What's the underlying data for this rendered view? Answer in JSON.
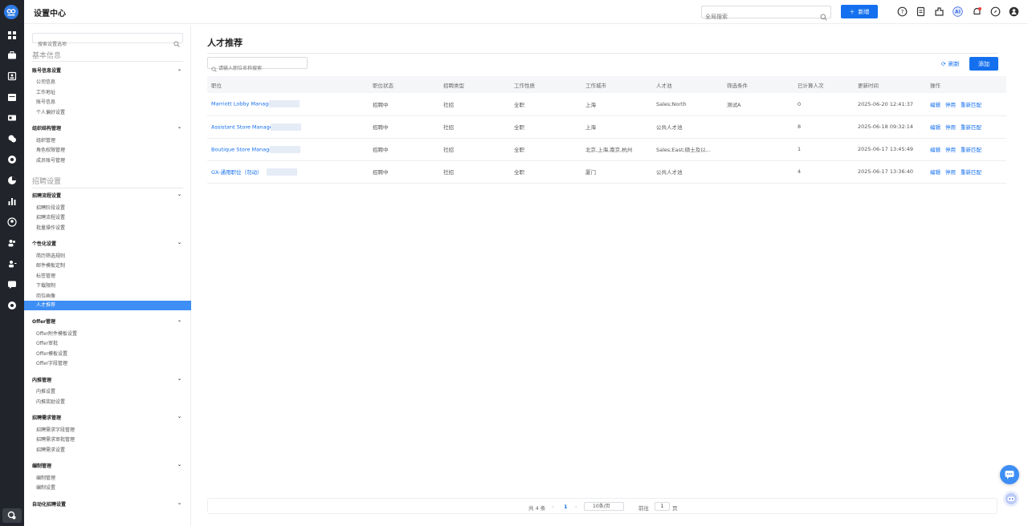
{
  "app": {
    "title": "设置中心"
  },
  "topbar": {
    "search_placeholder": "全局搜索",
    "new_label": "新增",
    "icons": [
      "help-icon",
      "document-icon",
      "plugin-icon",
      "ai-icon",
      "notification-icon",
      "compass-icon",
      "user-icon"
    ],
    "ai_label": "AI"
  },
  "sidebar": {
    "search_placeholder": "搜索设置选项",
    "sections": [
      {
        "title": "基本信息"
      },
      {
        "title": "招聘设置"
      }
    ],
    "groups": [
      {
        "label": "账号信息设置",
        "items": [
          "公司信息",
          "工作地址",
          "账号信息",
          "个人偏好设置"
        ]
      },
      {
        "label": "组织结构管理",
        "items": [
          "组织管理",
          "角色权限管理",
          "成员账号管理"
        ]
      },
      {
        "label": "招聘流程设置",
        "items": [
          "招聘阶段设置",
          "招聘流程设置",
          "批量操作设置"
        ]
      },
      {
        "label": "个性化设置",
        "items": [
          "简历筛选规则",
          "邮件模板定制",
          "标签管理",
          "下载限制",
          "岗位画像",
          "人才推荐"
        ]
      },
      {
        "label": "Offer管理",
        "items": [
          "Offer附件模板设置",
          "Offer审批",
          "Offer模板设置",
          "Offer字段管理"
        ]
      },
      {
        "label": "内推管理",
        "items": [
          "内推设置",
          "内推奖励设置"
        ]
      },
      {
        "label": "招聘需求管理",
        "items": [
          "招聘需求字段管理",
          "招聘需求审批管理",
          "招聘需求设置"
        ]
      },
      {
        "label": "编制管理",
        "items": [
          "编制管理",
          "编制设置"
        ]
      },
      {
        "label": "自动化招聘设置",
        "items": []
      }
    ],
    "active_item": "人才推荐"
  },
  "main": {
    "title": "人才推荐",
    "search_placeholder": "请输入职位名称搜索",
    "refresh_label": "刷新",
    "add_label": "添加",
    "columns": [
      "职位",
      "职位状态",
      "招聘类型",
      "工作性质",
      "工作城市",
      "人才池",
      "筛选条件",
      "已计算人次",
      "更新时间",
      "操作"
    ],
    "rows": [
      {
        "job": "Marriott Lobby Manage",
        "status": "招聘中",
        "type": "社招",
        "nature": "全职",
        "city": "上海",
        "pool": "Sales;North",
        "filter": "测试A",
        "count": "0",
        "updated": "2025-06-20 12:41:37"
      },
      {
        "job": "Assistant Store Manage",
        "status": "招聘中",
        "type": "社招",
        "nature": "全职",
        "city": "上海",
        "pool": "公共人才池",
        "filter": "",
        "count": "8",
        "updated": "2025-06-18 09:32:14"
      },
      {
        "job": "Boutique Store Manage",
        "status": "招聘中",
        "type": "社招",
        "nature": "全职",
        "city": "北京,上海,南京,杭州",
        "pool": "Sales;East;硕士及以...",
        "filter": "",
        "count": "1",
        "updated": "2025-06-17 13:45:49"
      },
      {
        "job": "GX-通用职位（勿动）",
        "status": "招聘中",
        "type": "社招",
        "nature": "全职",
        "city": "厦门",
        "pool": "公共人才池",
        "filter": "",
        "count": "4",
        "updated": "2025-06-17 13:36:40"
      }
    ],
    "actions": [
      "编辑",
      "停用",
      "重新匹配"
    ]
  },
  "pagination": {
    "total": "共 4 条",
    "current_page": "1",
    "page_size": "10条/页",
    "goto_label": "前往",
    "goto_value": "1",
    "page_suffix": "页"
  },
  "colors": {
    "accent": "#1570ef",
    "active_item": "#3d8ef5",
    "rail": "#21252b"
  }
}
